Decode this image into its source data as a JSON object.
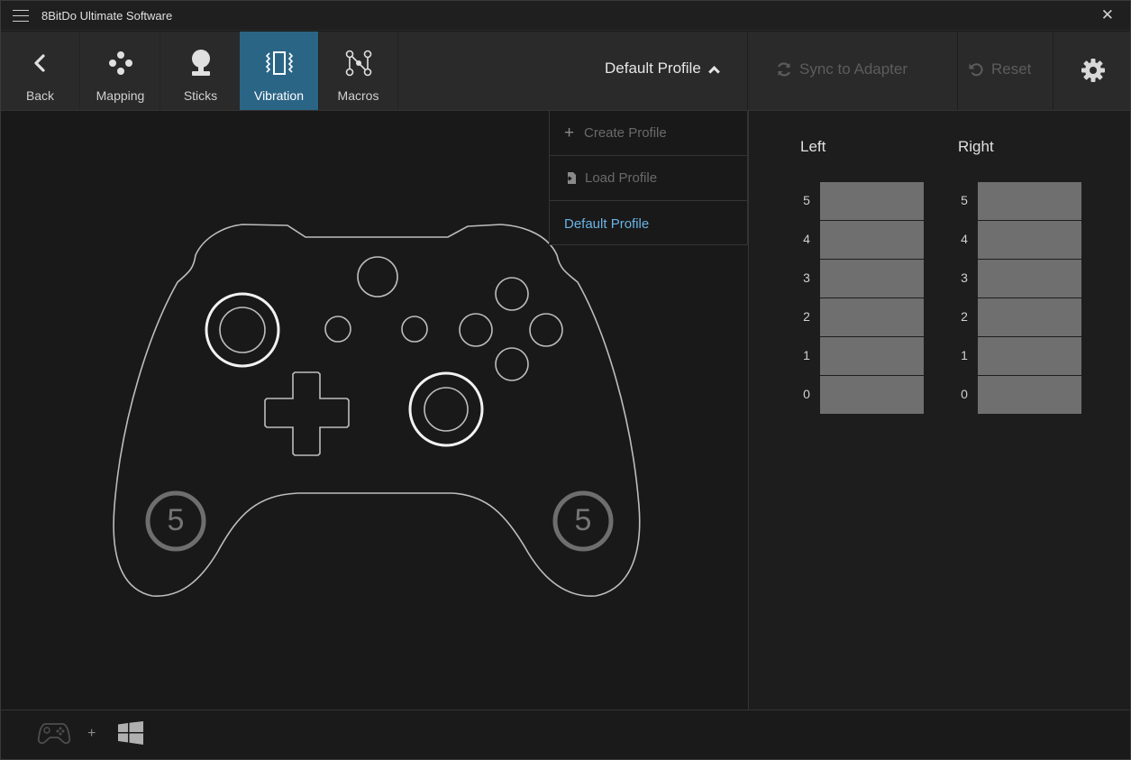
{
  "app": {
    "title": "8BitDo Ultimate Software"
  },
  "tabs": [
    {
      "label": "Back",
      "icon": "chevron-left-icon"
    },
    {
      "label": "Mapping",
      "icon": "buttons-icon"
    },
    {
      "label": "Sticks",
      "icon": "joystick-icon"
    },
    {
      "label": "Vibration",
      "icon": "vibration-icon",
      "active": true
    },
    {
      "label": "Macros",
      "icon": "macros-icon"
    }
  ],
  "toolbar": {
    "profile_label": "Default Profile",
    "sync_label": "Sync to Adapter",
    "reset_label": "Reset"
  },
  "profile_menu": {
    "create_label": "Create Profile",
    "load_label": "Load Profile",
    "profiles": [
      "Default Profile"
    ],
    "selected": "Default Profile"
  },
  "controller": {
    "left_motor_level": "5",
    "right_motor_level": "5"
  },
  "vibration": {
    "left_title": "Left",
    "right_title": "Right",
    "levels": [
      "5",
      "4",
      "3",
      "2",
      "1",
      "0"
    ]
  },
  "footer": {
    "plus": "+"
  },
  "colors": {
    "accent": "#2b6586",
    "selected_text": "#6ab4e6",
    "bar": "#6f6f6f"
  }
}
